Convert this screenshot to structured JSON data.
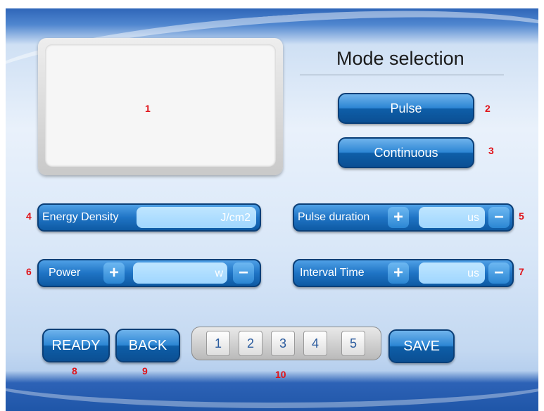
{
  "display": {
    "callout": "1"
  },
  "mode": {
    "title": "Mode selection",
    "pulse_label": "Pulse",
    "pulse_callout": "2",
    "continuous_label": "Continuous",
    "continuous_callout": "3"
  },
  "energy_density": {
    "callout": "4",
    "label": "Energy Density",
    "unit": "J/cm2"
  },
  "pulse_duration": {
    "callout": "5",
    "label": "Pulse duration",
    "plus": "+",
    "unit": "us",
    "minus": "−"
  },
  "power": {
    "callout": "6",
    "label": "Power",
    "plus": "+",
    "unit": "w",
    "minus": "−"
  },
  "interval_time": {
    "callout": "7",
    "label": "Interval Time",
    "plus": "+",
    "unit": "us",
    "minus": "−"
  },
  "footer": {
    "ready_label": "READY",
    "ready_callout": "8",
    "back_label": "BACK",
    "back_callout": "9",
    "presets": [
      "1",
      "2",
      "3",
      "4",
      "5"
    ],
    "presets_callout": "10",
    "save_label": "SAVE"
  },
  "colors": {
    "button_blue": "#1f74c5",
    "field_cyan": "#9fd6ff",
    "callout_red": "#e0141a"
  }
}
